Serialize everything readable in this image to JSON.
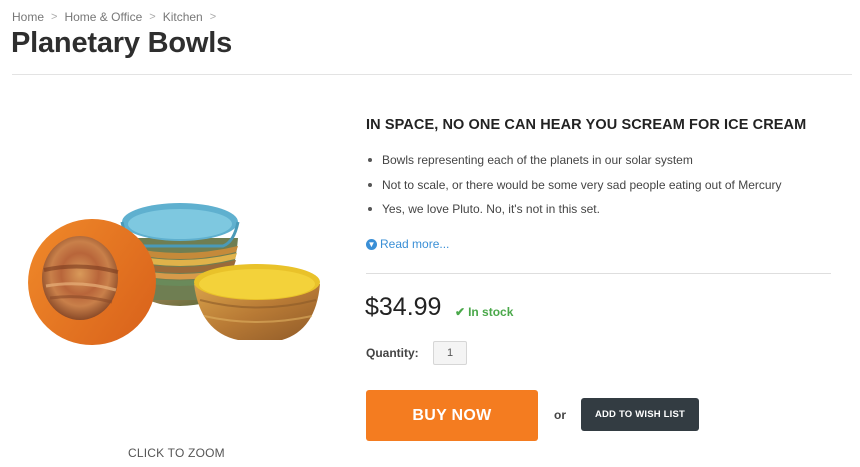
{
  "breadcrumb": {
    "items": [
      {
        "label": "Home"
      },
      {
        "label": "Home & Office"
      },
      {
        "label": "Kitchen"
      }
    ],
    "separator": ">"
  },
  "page_title": "Planetary Bowls",
  "product": {
    "image_caption": "CLICK TO ZOOM",
    "headline": "IN SPACE, NO ONE CAN HEAR YOU SCREAM FOR ICE CREAM",
    "features": [
      "Bowls representing each of the planets in our solar system",
      "Not to scale, or there would be some very sad people eating out of Mercury",
      "Yes, we love Pluto. No, it's not in this set."
    ],
    "read_more": "Read more...",
    "price": "$34.99",
    "stock_status": "In stock",
    "quantity_label": "Quantity:",
    "quantity_value": "1",
    "buy_now_label": "BUY NOW",
    "or_label": "or",
    "wish_list_label": "ADD TO WISH LIST"
  },
  "colors": {
    "accent_orange": "#f47c20",
    "link_blue": "#3a8fd6",
    "stock_green": "#4aa84a",
    "dark_button": "#333c42"
  },
  "icons": {
    "read_more": "circle-arrow-down-icon",
    "stock": "checkmark-icon"
  }
}
